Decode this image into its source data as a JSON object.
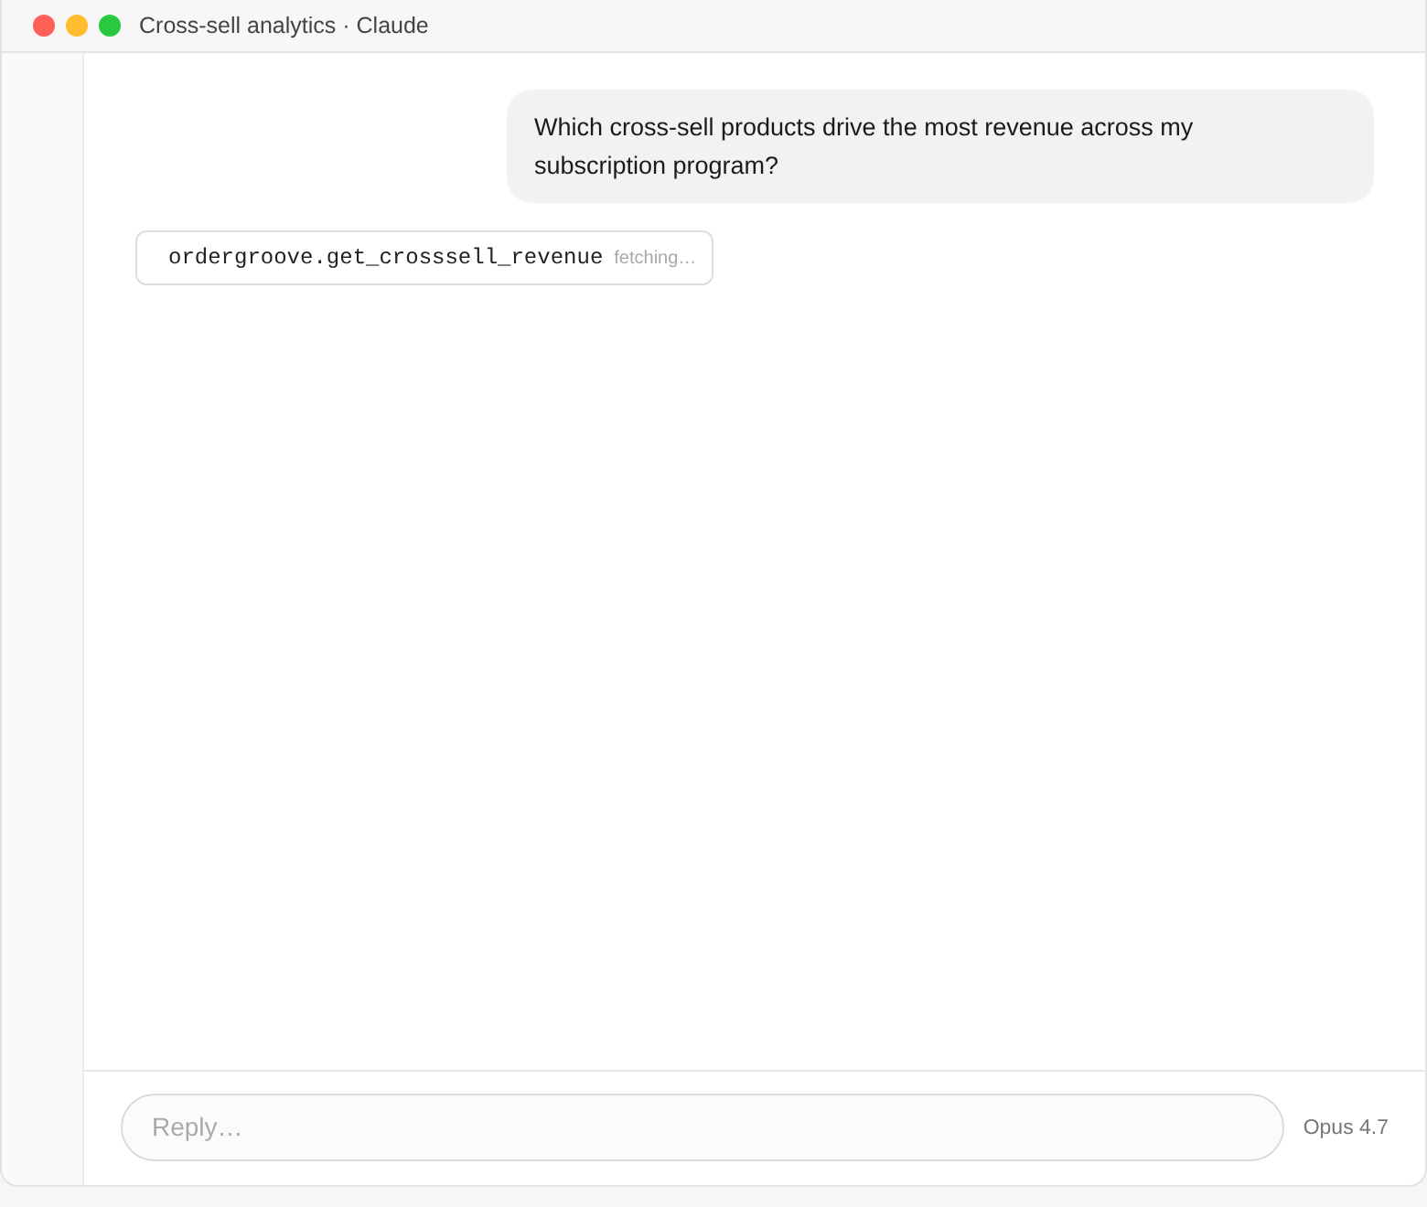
{
  "window": {
    "title": "Cross-sell analytics · Claude"
  },
  "messages": [
    {
      "kind": "user",
      "text": "Which cross-sell products drive the most revenue across my subscription program?"
    },
    {
      "kind": "tool_call",
      "name": "ordergroove.get_crosssell_revenue",
      "status": "fetching…"
    }
  ],
  "composer": {
    "placeholder": "Reply…"
  },
  "model": "Opus 4.7"
}
